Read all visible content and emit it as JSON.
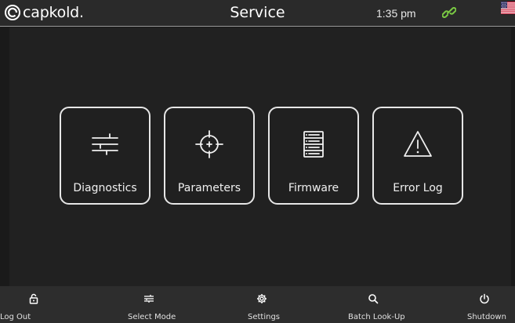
{
  "header": {
    "brand": "capkold.",
    "title": "Service",
    "time": "1:35 pm",
    "link_icon": "link-icon",
    "flag_icon": "us-flag-icon",
    "link_color": "#7ac943"
  },
  "tiles": [
    {
      "label": "Diagnostics",
      "icon": "sliders-icon"
    },
    {
      "label": "Parameters",
      "icon": "crosshair-icon"
    },
    {
      "label": "Firmware",
      "icon": "list-icon"
    },
    {
      "label": "Error Log",
      "icon": "warning-icon"
    }
  ],
  "bottom_nav": [
    {
      "label": "Log Out",
      "icon": "lock-icon"
    },
    {
      "label": "Select Mode",
      "icon": "sliders-icon"
    },
    {
      "label": "Settings",
      "icon": "gear-icon"
    },
    {
      "label": "Batch Look-Up",
      "icon": "search-icon"
    },
    {
      "label": "Shutdown",
      "icon": "power-icon"
    }
  ]
}
